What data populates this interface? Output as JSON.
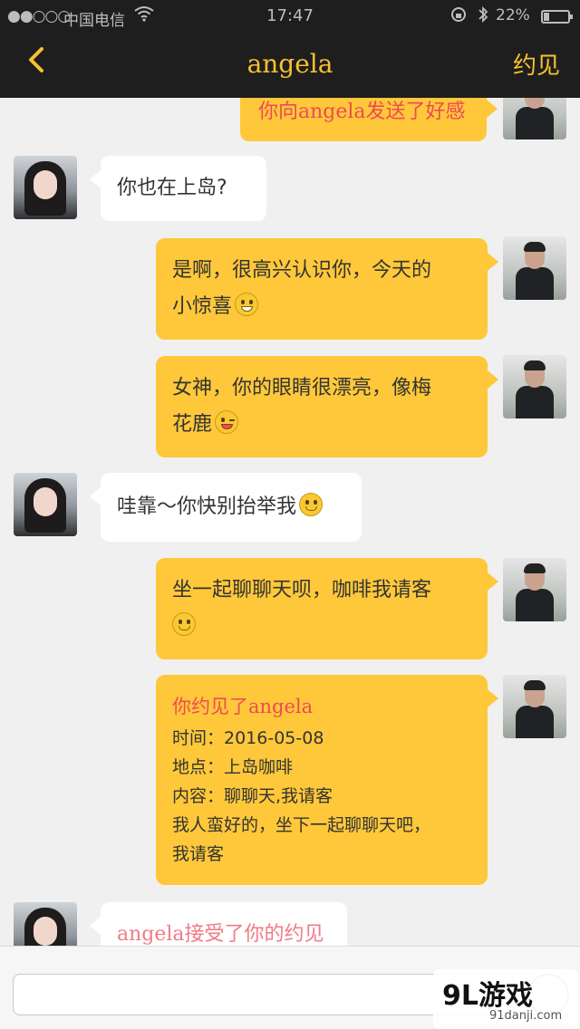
{
  "status_bar": {
    "signal": "●●○○○",
    "carrier": "中国电信",
    "time": "17:47",
    "battery": "22%",
    "battery_level": 0.22
  },
  "nav": {
    "back_label": "‹",
    "title": "angela",
    "action_label": "约见"
  },
  "messages": [
    {
      "from": "me",
      "type": "system",
      "text": "你向angela发送了好感"
    },
    {
      "from": "angela",
      "type": "text",
      "text": "你也在上岛?"
    },
    {
      "from": "me",
      "type": "text",
      "lines": [
        "是啊，很高兴认识你，今天的",
        "小惊喜"
      ],
      "emoji": "grin"
    },
    {
      "from": "me",
      "type": "text",
      "lines": [
        "女神，你的眼睛很漂亮，像梅",
        "花鹿"
      ],
      "emoji": "wink"
    },
    {
      "from": "angela",
      "type": "text",
      "text": "哇靠～你快别抬举我",
      "emoji": "smile"
    },
    {
      "from": "me",
      "type": "text",
      "lines": [
        "坐一起聊聊天呗，咖啡我请客"
      ],
      "emoji": "smile"
    },
    {
      "from": "me",
      "type": "invitation",
      "title": "你约见了angela",
      "time": "时间：2016-05-08",
      "place": "地点：上岛咖啡",
      "content": "内容：聊聊天,我请客",
      "note_lines": [
        "我人蛮好的，坐下一起聊聊天吧，",
        "我请客"
      ]
    },
    {
      "from": "angela",
      "type": "system",
      "text": "angela接受了你的约见"
    }
  ],
  "input": {
    "value": "",
    "placeholder": ""
  },
  "watermark": {
    "main": "9L游戏",
    "sub": "91danji.com"
  }
}
